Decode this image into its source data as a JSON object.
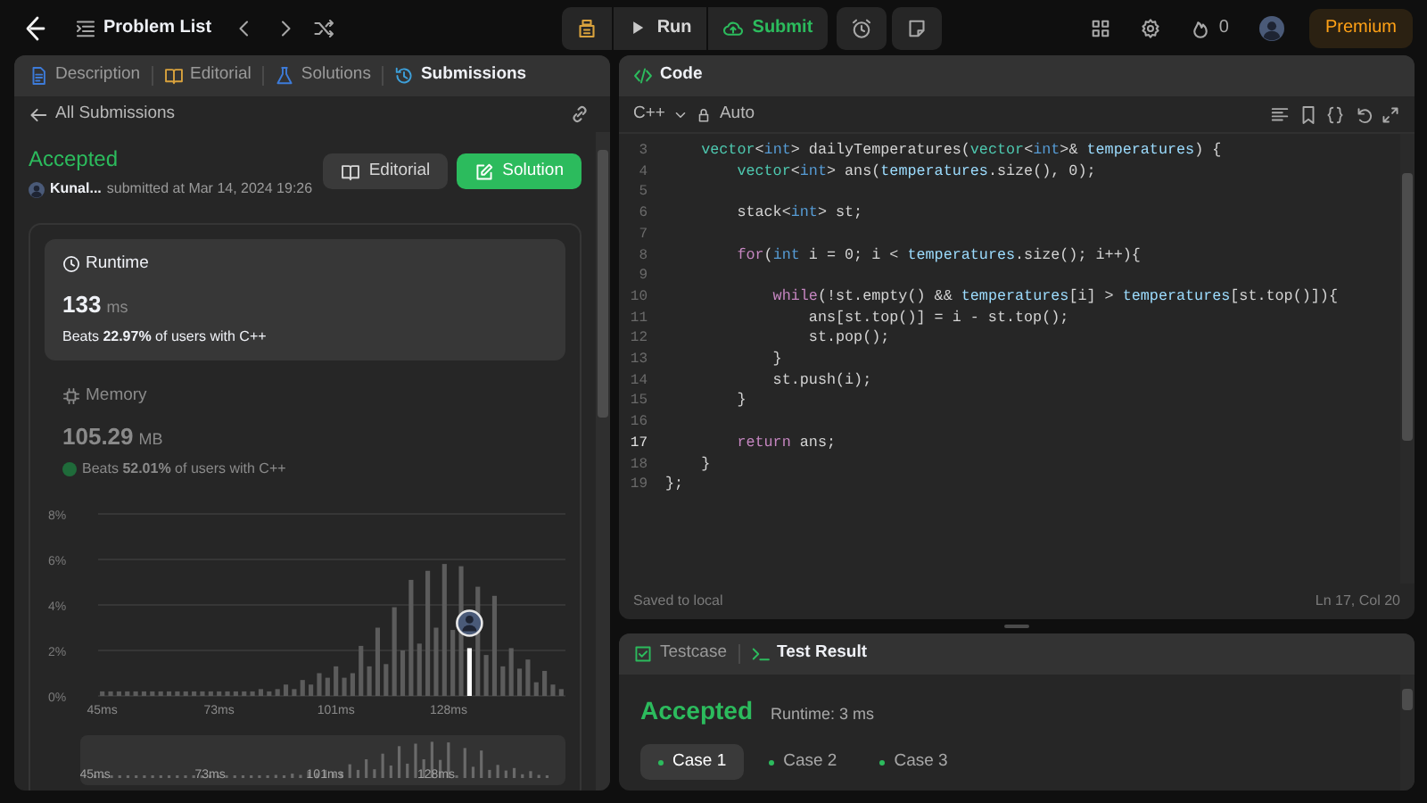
{
  "top_bar": {
    "title": "Problem List",
    "run": "Run",
    "submit": "Submit",
    "streak": "0",
    "premium": "Premium"
  },
  "left_panel": {
    "tabs": [
      {
        "label": "Description",
        "kind": "document",
        "selected": false
      },
      {
        "label": "Editorial",
        "kind": "book",
        "selected": false
      },
      {
        "label": "Solutions",
        "kind": "flask",
        "selected": false
      },
      {
        "label": "Submissions",
        "kind": "history",
        "selected": true
      }
    ],
    "back_label": "All Submissions",
    "submission": {
      "status": "Accepted",
      "author": "Kunal...",
      "meta": "submitted at Mar 14, 2024 19:26",
      "buttons": [
        {
          "label": "Editorial",
          "kind": "book"
        },
        {
          "label": "Solution",
          "kind": "edit"
        }
      ]
    },
    "stats": [
      {
        "kind": "clock",
        "title": "Runtime",
        "value": "133",
        "unit": "ms",
        "beats": "Beats **22.97%** of users with C++",
        "selected": true
      },
      {
        "kind": "chip",
        "title": "Memory",
        "value": "105.29",
        "unit": "MB",
        "beats": "Beats **52.01%** of users with C++",
        "selected": false
      }
    ],
    "chart_data": {
      "type": "bar",
      "grid": true,
      "x": [
        45,
        47,
        49,
        51,
        53,
        55,
        57,
        59,
        61,
        63,
        65,
        67,
        69,
        71,
        73,
        75,
        77,
        79,
        81,
        83,
        85,
        87,
        89,
        91,
        93,
        95,
        97,
        99,
        101,
        103,
        105,
        107,
        109,
        111,
        113,
        115,
        117,
        119,
        121,
        123,
        125,
        127,
        129,
        131,
        133,
        135,
        137,
        139,
        141,
        143,
        145,
        147,
        149,
        151,
        153,
        155
      ],
      "series": [
        {
          "color": "#5c5c5c",
          "values": [
            0.2,
            0.2,
            0.2,
            0.2,
            0.2,
            0.2,
            0.2,
            0.2,
            0.2,
            0.2,
            0.2,
            0.2,
            0.2,
            0.2,
            0.2,
            0.2,
            0.2,
            0.2,
            0.2,
            0.3,
            0.2,
            0.3,
            0.5,
            0.3,
            0.7,
            0.5,
            1.0,
            0.8,
            1.3,
            0.8,
            1.0,
            2.2,
            1.3,
            3.0,
            1.4,
            3.9,
            2.0,
            5.1,
            2.3,
            5.5,
            3.0,
            5.8,
            2.9,
            5.7,
            null,
            4.8,
            1.8,
            4.4,
            1.3,
            2.1,
            1.2,
            1.6,
            0.6,
            1.1,
            0.5,
            0.3
          ]
        },
        {
          "color": "#ffffff",
          "values": [
            null,
            null,
            null,
            null,
            null,
            null,
            null,
            null,
            null,
            null,
            null,
            null,
            null,
            null,
            null,
            null,
            null,
            null,
            null,
            null,
            null,
            null,
            null,
            null,
            null,
            null,
            null,
            null,
            null,
            null,
            null,
            null,
            null,
            null,
            null,
            null,
            null,
            null,
            null,
            null,
            null,
            null,
            null,
            null,
            2.1,
            null,
            null,
            null,
            null,
            null,
            null,
            null,
            null,
            null,
            null,
            null
          ]
        }
      ],
      "xlim": [
        44,
        156
      ],
      "ylim": [
        0,
        8
      ],
      "yticks": [
        {
          "value": 0,
          "label": "0%"
        },
        {
          "value": 2,
          "label": "2%"
        },
        {
          "value": 4,
          "label": "4%"
        },
        {
          "value": 6,
          "label": "6%"
        },
        {
          "value": 8,
          "label": "8%"
        }
      ],
      "xticks": [
        {
          "value": 45,
          "label": "45ms"
        },
        {
          "value": 73,
          "label": "73ms"
        },
        {
          "value": 101,
          "label": "101ms"
        },
        {
          "value": 128,
          "label": "128ms"
        }
      ]
    },
    "overview_labels": [
      "45ms",
      "73ms",
      "101ms",
      "128ms"
    ]
  },
  "editor": {
    "title": "Code",
    "language": "C++",
    "mode": "Auto",
    "lines": [
      {
        "number": "3",
        "current": false,
        "tokens": [
          {
            "text": "    vector",
            "kind": "type"
          },
          {
            "text": "<",
            "kind": "plain"
          },
          {
            "text": "int",
            "kind": "keyword"
          },
          {
            "text": "> dailyTemperatures(",
            "kind": "plain"
          },
          {
            "text": "vector",
            "kind": "type"
          },
          {
            "text": "<",
            "kind": "plain"
          },
          {
            "text": "int",
            "kind": "keyword"
          },
          {
            "text": ">& ",
            "kind": "plain"
          },
          {
            "text": "temperatures",
            "kind": "variable"
          },
          {
            "text": ") {",
            "kind": "plain"
          }
        ]
      },
      {
        "number": "4",
        "current": false,
        "tokens": [
          {
            "text": "        vector",
            "kind": "type"
          },
          {
            "text": "<",
            "kind": "plain"
          },
          {
            "text": "int",
            "kind": "keyword"
          },
          {
            "text": "> ans(",
            "kind": "plain"
          },
          {
            "text": "temperatures",
            "kind": "variable"
          },
          {
            "text": ".size(), 0);",
            "kind": "plain"
          }
        ]
      },
      {
        "number": "5",
        "current": false
      },
      {
        "number": "6",
        "current": false,
        "tokens": [
          {
            "text": "        stack<",
            "kind": "plain"
          },
          {
            "text": "int",
            "kind": "keyword"
          },
          {
            "text": "> st;",
            "kind": "plain"
          }
        ]
      },
      {
        "number": "7",
        "current": false
      },
      {
        "number": "8",
        "current": false,
        "tokens": [
          {
            "text": "        for",
            "kind": "control"
          },
          {
            "text": "(",
            "kind": "plain"
          },
          {
            "text": "int",
            "kind": "keyword"
          },
          {
            "text": " i = 0; i < ",
            "kind": "plain"
          },
          {
            "text": "temperatures",
            "kind": "variable"
          },
          {
            "text": ".size(); i++){",
            "kind": "plain"
          }
        ]
      },
      {
        "number": "9",
        "current": false
      },
      {
        "number": "10",
        "current": false,
        "tokens": [
          {
            "text": "            while",
            "kind": "control"
          },
          {
            "text": "(!st.empty() && ",
            "kind": "plain"
          },
          {
            "text": "temperatures",
            "kind": "variable"
          },
          {
            "text": "[i] > ",
            "kind": "plain"
          },
          {
            "text": "temperatures",
            "kind": "variable"
          },
          {
            "text": "[st.top()]){",
            "kind": "plain"
          }
        ]
      },
      {
        "number": "11",
        "current": false,
        "tokens": [
          {
            "text": "                ans[st.top()] = i - st.top();",
            "kind": "plain"
          }
        ]
      },
      {
        "number": "12",
        "current": false,
        "tokens": [
          {
            "text": "                st.pop();",
            "kind": "plain"
          }
        ]
      },
      {
        "number": "13",
        "current": false,
        "tokens": [
          {
            "text": "            }",
            "kind": "plain"
          }
        ]
      },
      {
        "number": "14",
        "current": false,
        "tokens": [
          {
            "text": "            st.push(i);",
            "kind": "plain"
          }
        ]
      },
      {
        "number": "15",
        "current": false,
        "tokens": [
          {
            "text": "        }",
            "kind": "plain"
          }
        ]
      },
      {
        "number": "16",
        "current": false
      },
      {
        "number": "17",
        "current": true,
        "tokens": [
          {
            "text": "        return",
            "kind": "control"
          },
          {
            "text": " ans;",
            "kind": "plain"
          }
        ]
      },
      {
        "number": "18",
        "current": false,
        "tokens": [
          {
            "text": "    }",
            "kind": "plain"
          }
        ]
      },
      {
        "number": "19",
        "current": false,
        "tokens": [
          {
            "text": "};",
            "kind": "plain"
          }
        ]
      }
    ],
    "status_left": "Saved to local",
    "status_right": "Ln 17, Col 20"
  },
  "results": {
    "tabs": [
      {
        "label": "Testcase",
        "kind": "check",
        "selected": false
      },
      {
        "label": "Test Result",
        "kind": "terminal",
        "selected": true
      }
    ],
    "status": "Accepted",
    "runtime": "Runtime: 3 ms",
    "cases": [
      {
        "label": "Case 1",
        "selected": true
      },
      {
        "label": "Case 2",
        "selected": false
      },
      {
        "label": "Case 3",
        "selected": false
      }
    ]
  }
}
